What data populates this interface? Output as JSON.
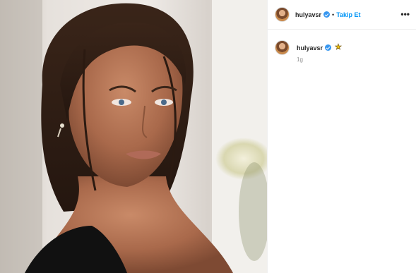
{
  "post": {
    "image_alt_icon": "portrait-photo",
    "header": {
      "username": "hulyavsr",
      "separator": "•",
      "follow_label": "Takip Et",
      "more_label": "•••",
      "verified_icon": "verified-badge-icon"
    },
    "caption": {
      "username": "hulyavsr",
      "emoji": "★",
      "timestamp": "1g"
    }
  },
  "colors": {
    "link": "#0095f6",
    "verified": "#3897f0",
    "muted": "#8e8e8e",
    "text": "#262626"
  }
}
